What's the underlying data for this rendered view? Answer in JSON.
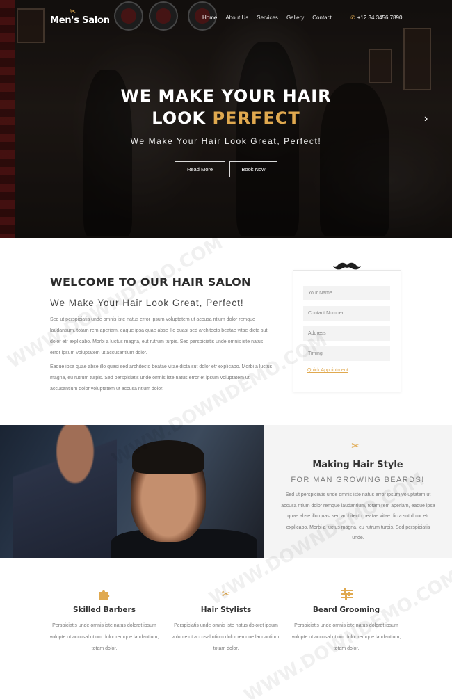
{
  "header": {
    "logo": "Men's Salon",
    "nav": [
      "Home",
      "About Us",
      "Services",
      "Gallery",
      "Contact"
    ],
    "phone": "+12 34 3456 7890",
    "icons": {
      "logo": "scissors-icon",
      "phone": "phone-icon"
    }
  },
  "hero": {
    "title_line1": "WE MAKE YOUR HAIR",
    "title_line2_white": "LOOK",
    "title_line2_accent": "PERFECT",
    "subtitle": "We Make Your Hair Look Great, Perfect!",
    "btn_read_more": "Read More",
    "btn_book_now": "Book Now",
    "next_arrow": "›"
  },
  "welcome": {
    "title": "WELCOME TO OUR HAIR SALON",
    "subtitle": "We Make Your Hair Look Great, Perfect!",
    "p1": "Sed ut perspiciatis unde omnis iste natus error ipsum voluptatem ut accusa ntium dolor remque laudantium, totam rem aperiam, eaque ipsa quae abse illo quasi sed architecto beatae vitae dicta sut dolor etr explicabo. Morbi a luctus magna, eut rutrum turpis. Sed perspiciatis unde omnis iste natus error ipsum voluptatem ut accusantium dolor.",
    "p2": "Eaque ipsa quae abse illo quasi sed architecto beatae vitae dicta sut dolor etr explicabo. Morbi a luctus magna, eu rutrum turpis. Sed perspiciatis unde omnis iste natus error et ipsum voluptatem ut accusantium dolor voluptatem ut accusa ntium dolor."
  },
  "booking_form": {
    "name_placeholder": "Your Name",
    "contact_placeholder": "Contact Number",
    "address_placeholder": "Address",
    "timing_placeholder": "Timing",
    "quick_link": "Quick Appointment",
    "icon": "mustache-icon"
  },
  "feature": {
    "title": "Making Hair Style",
    "subtitle": "FOR MAN GROWING BEARDS!",
    "body": "Sed ut perspiciatis unde omnis iste natus error ipsum voluptatem ut accusa ntium dolor remque laudantium, totam rem aperiam, eaque ipsa quae abse illo quasi sed architecto beatae vitae dicta sut dolor etr explicabo. Morbi a luctus magna, eu rutrum turpis. Sed perspiciatis unde.",
    "icon": "scissors-icon"
  },
  "services": [
    {
      "title": "Skilled Barbers",
      "icon": "puzzle-icon",
      "body": "Perspiciatis unde omnis iste natus doloret ipsum volupte ut accusal ntium dolor remque laudantium, totam dolor."
    },
    {
      "title": "Hair Stylists",
      "icon": "scissors-icon",
      "body": "Perspiciatis unde omnis iste natus doloret ipsum volupte ut accusal ntium dolor remque laudantium, totam dolor."
    },
    {
      "title": "Beard Grooming",
      "icon": "sliders-icon",
      "body": "Perspiciatis unde omnis iste natus doloret ipsum volupte ut accusal ntium dolor remque laudantium, totam dolor."
    }
  ],
  "watermark": "WWW.DOWNDEMO.COM",
  "colors": {
    "accent": "#e0a94f",
    "heading": "#2c2c2c",
    "body_text": "#7a7a7a",
    "panel_bg": "#f4f4f4"
  }
}
